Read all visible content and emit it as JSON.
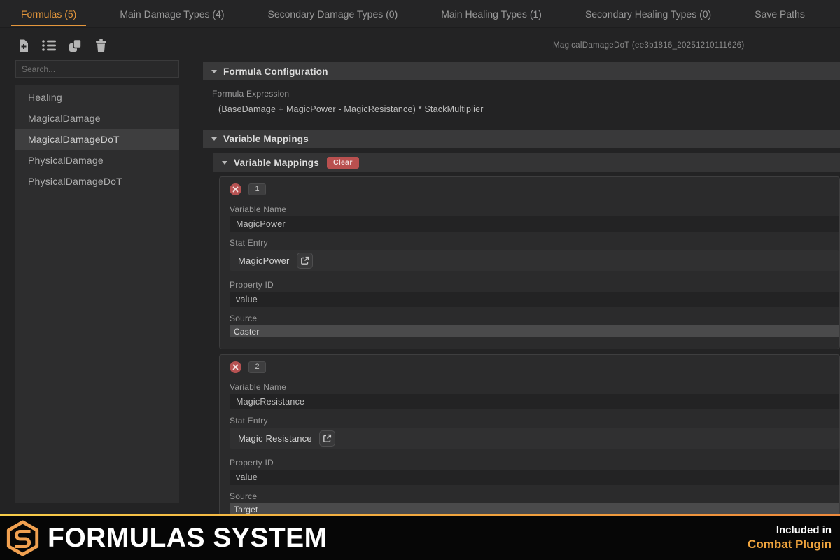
{
  "colors": {
    "accent_orange": "#e5973c",
    "danger_red": "#b9504f",
    "logo_orange": "#f0a050",
    "footer_gradient_start": "#f7cd49",
    "footer_gradient_end": "#ee8a3c"
  },
  "tabs": [
    {
      "label": "Formulas (5)",
      "active": true
    },
    {
      "label": "Main Damage Types (4)",
      "active": false
    },
    {
      "label": "Secondary Damage Types (0)",
      "active": false
    },
    {
      "label": "Main Healing Types (1)",
      "active": false
    },
    {
      "label": "Secondary Healing Types (0)",
      "active": false
    },
    {
      "label": "Save Paths",
      "active": false
    }
  ],
  "sidebar": {
    "toolbar_icons": [
      "new-file-icon",
      "list-icon",
      "duplicate-icon",
      "trash-icon"
    ],
    "search_placeholder": "Search...",
    "items": [
      {
        "label": "Healing",
        "selected": false
      },
      {
        "label": "MagicalDamage",
        "selected": false
      },
      {
        "label": "MagicalDamageDoT",
        "selected": true
      },
      {
        "label": "PhysicalDamage",
        "selected": false
      },
      {
        "label": "PhysicalDamageDoT",
        "selected": false
      }
    ]
  },
  "content": {
    "doc_title": "MagicalDamageDoT (ee3b1816_20251210111626)",
    "formula_section": {
      "title": "Formula Configuration",
      "expression_label": "Formula Expression",
      "expression_value": "(BaseDamage + MagicPower - MagicResistance) * StackMultiplier"
    },
    "mappings_section": {
      "title": "Variable Mappings",
      "inner_title": "Variable Mappings",
      "clear_label": "Clear",
      "field_labels": {
        "variable_name": "Variable Name",
        "stat_entry": "Stat Entry",
        "property_id": "Property ID",
        "source": "Source"
      },
      "entries": [
        {
          "index": "1",
          "variable_name": "MagicPower",
          "stat_entry": "MagicPower",
          "property_id": "value",
          "source": "Caster"
        },
        {
          "index": "2",
          "variable_name": "MagicResistance",
          "stat_entry": "Magic Resistance",
          "property_id": "value",
          "source": "Target"
        }
      ]
    }
  },
  "footer": {
    "title": "FORMULAS SYSTEM",
    "included_in": "Included in",
    "plugin_name": "Combat Plugin"
  }
}
